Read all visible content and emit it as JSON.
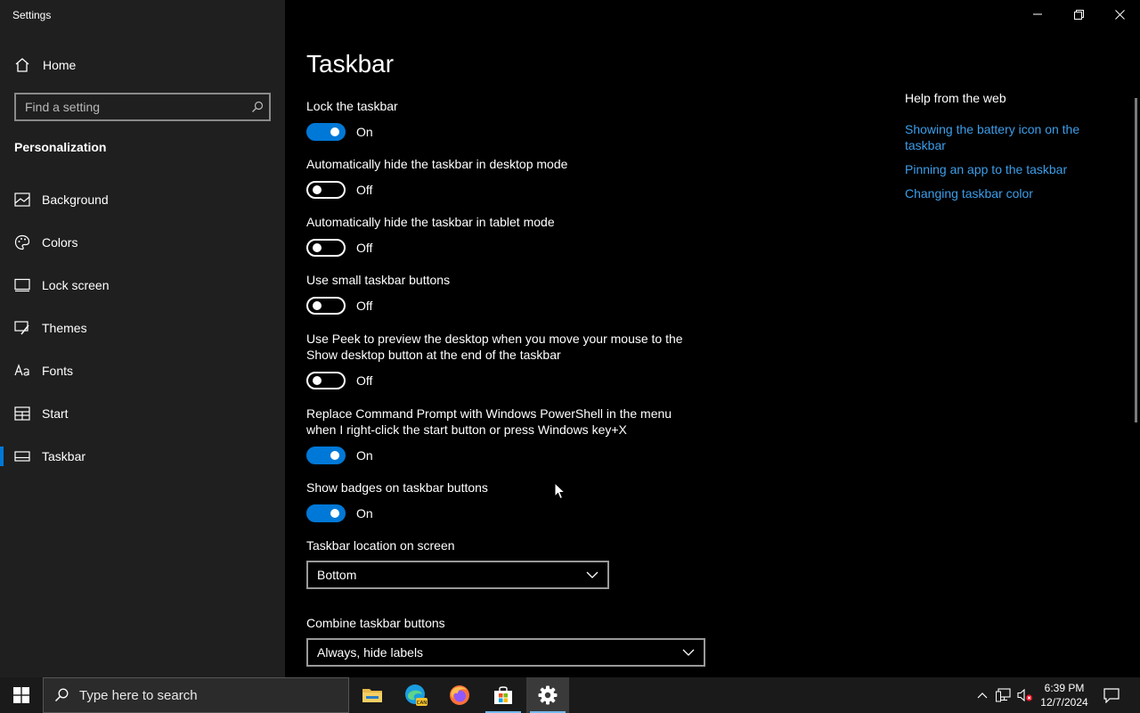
{
  "window": {
    "app_title": "Settings"
  },
  "sidebar": {
    "home_label": "Home",
    "search_placeholder": "Find a setting",
    "section_title": "Personalization",
    "items": [
      {
        "label": "Background",
        "icon": "picture-icon"
      },
      {
        "label": "Colors",
        "icon": "palette-icon"
      },
      {
        "label": "Lock screen",
        "icon": "lock-screen-icon"
      },
      {
        "label": "Themes",
        "icon": "brush-icon"
      },
      {
        "label": "Fonts",
        "icon": "font-icon"
      },
      {
        "label": "Start",
        "icon": "start-tiles-icon"
      },
      {
        "label": "Taskbar",
        "icon": "taskbar-icon",
        "selected": true
      }
    ]
  },
  "main": {
    "title": "Taskbar",
    "settings": [
      {
        "label": "Lock the taskbar",
        "state": "On"
      },
      {
        "label": "Automatically hide the taskbar in desktop mode",
        "state": "Off"
      },
      {
        "label": "Automatically hide the taskbar in tablet mode",
        "state": "Off"
      },
      {
        "label": "Use small taskbar buttons",
        "state": "Off"
      },
      {
        "label": "Use Peek to preview the desktop when you move your mouse to the Show desktop button at the end of the taskbar",
        "state": "Off"
      },
      {
        "label": "Replace Command Prompt with Windows PowerShell in the menu when I right-click the start button or press Windows key+X",
        "state": "On"
      },
      {
        "label": "Show badges on taskbar buttons",
        "state": "On"
      }
    ],
    "location": {
      "label": "Taskbar location on screen",
      "value": "Bottom"
    },
    "combine": {
      "label": "Combine taskbar buttons",
      "value": "Always, hide labels"
    }
  },
  "help": {
    "title": "Help from the web",
    "links": [
      "Showing the battery icon on the taskbar",
      "Pinning an app to the taskbar",
      "Changing taskbar color"
    ]
  },
  "taskbar": {
    "search_placeholder": "Type here to search",
    "apps": [
      "file-explorer-icon",
      "edge-canary-icon",
      "firefox-icon",
      "microsoft-store-icon",
      "settings-gear-icon"
    ],
    "time": "6:39 PM",
    "date": "12/7/2024"
  },
  "colors": {
    "accent": "#0078d7",
    "link": "#3c9eea",
    "sidebar_bg": "#1f1f1f",
    "main_bg": "#000000"
  }
}
